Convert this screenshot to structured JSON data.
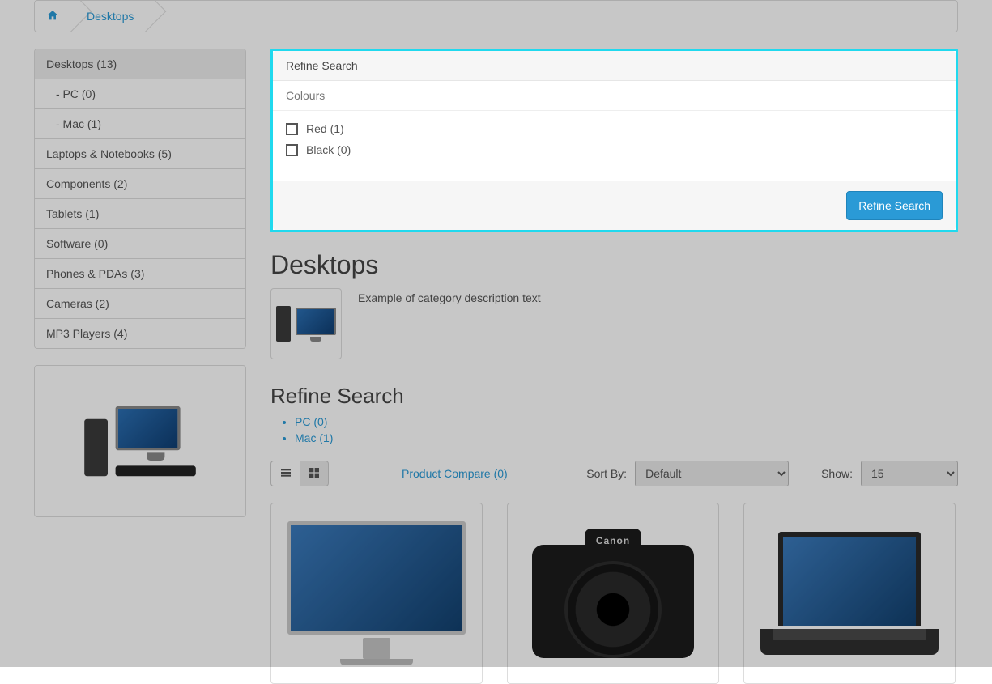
{
  "breadcrumb": {
    "items": [
      {
        "label": "",
        "is_home": true
      },
      {
        "label": "Desktops"
      }
    ]
  },
  "sidebar": {
    "categories": [
      {
        "label": "Desktops (13)",
        "active": true
      },
      {
        "label": "   - PC (0)",
        "sub": true
      },
      {
        "label": "   - Mac (1)",
        "sub": true
      },
      {
        "label": "Laptops & Notebooks (5)"
      },
      {
        "label": "Components (2)"
      },
      {
        "label": "Tablets (1)"
      },
      {
        "label": "Software (0)"
      },
      {
        "label": "Phones & PDAs (3)"
      },
      {
        "label": "Cameras (2)"
      },
      {
        "label": "MP3 Players (4)"
      }
    ]
  },
  "refine_panel": {
    "title": "Refine Search",
    "group_label": "Colours",
    "options": [
      {
        "label": "Red (1)"
      },
      {
        "label": "Black (0)"
      }
    ],
    "button": "Refine Search"
  },
  "page_title": "Desktops",
  "category_description": "Example of category description text",
  "refine_section": {
    "title": "Refine Search",
    "links": [
      {
        "label": "PC (0)"
      },
      {
        "label": "Mac (1)"
      }
    ]
  },
  "toolbar": {
    "compare_label": "Product Compare (0)",
    "sort_label": "Sort By:",
    "sort_value": "Default",
    "show_label": "Show:",
    "show_value": "15"
  },
  "camera_brand": "Canon"
}
